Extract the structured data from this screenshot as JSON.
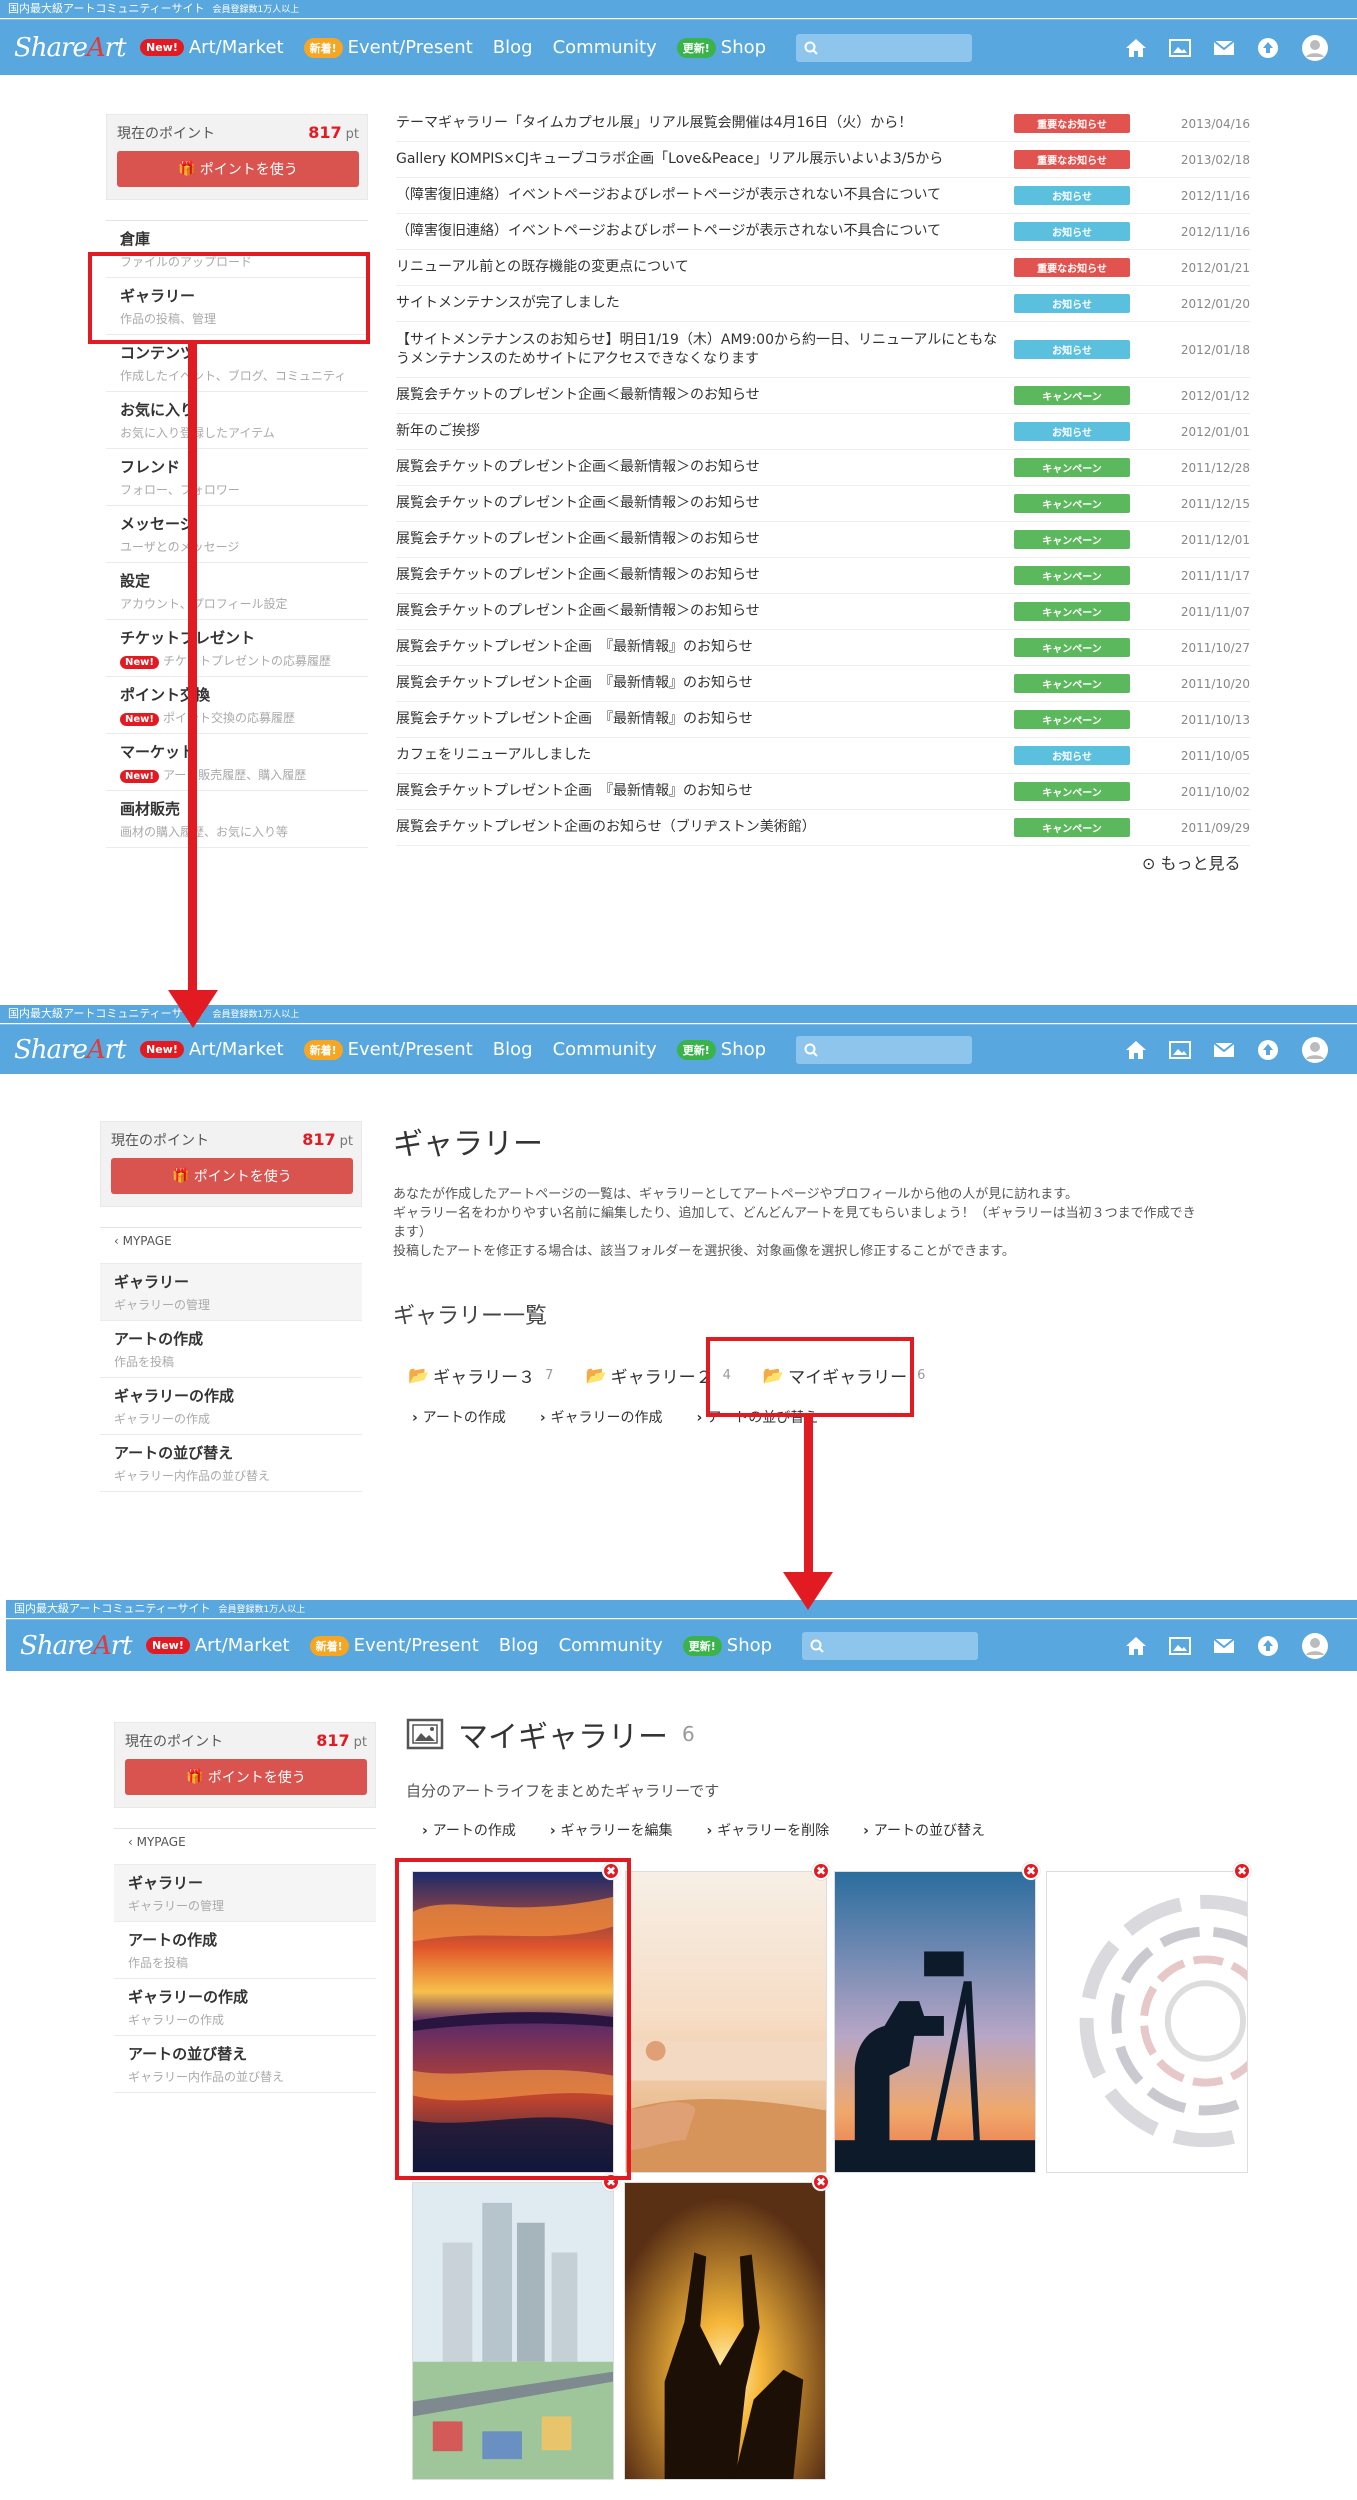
{
  "site": {
    "strip_main": "国内最大級アートコミュニティーサイト",
    "strip_sub": "会員登録数1万人以上",
    "logo": {
      "text_s": "S",
      "text_hare": "hare",
      "text_a": "A",
      "text_rt": "rt"
    },
    "nav": [
      {
        "badge": "New!",
        "badge_color": "#e21b23",
        "label": "Art/Market"
      },
      {
        "badge": "新着!",
        "badge_color": "#f6a623",
        "label": "Event/Present"
      },
      {
        "badge": "",
        "label": "Blog"
      },
      {
        "badge": "",
        "label": "Community"
      },
      {
        "badge": "更新!",
        "badge_color": "#3ab44a",
        "label": "Shop"
      }
    ],
    "icons": [
      "home-icon",
      "gallery-icon",
      "mail-icon",
      "upload-icon",
      "avatar-icon"
    ]
  },
  "points": {
    "label": "現在のポイント",
    "value": "817",
    "unit": "pt",
    "button": "ポイントを使う"
  },
  "screen1": {
    "sidebar": [
      {
        "title": "倉庫",
        "sub": "ファイルのアップロード"
      },
      {
        "title": "ギャラリー",
        "sub": "作品の投稿、管理"
      },
      {
        "title": "コンテンツ",
        "sub": "作成したイベント、ブログ、コミュニティ"
      },
      {
        "title": "お気に入り",
        "sub": "お気に入り登録したアイテム"
      },
      {
        "title": "フレンド",
        "sub": "フォロー、フォロワー"
      },
      {
        "title": "メッセージ",
        "sub": "ユーザとのメッセージ"
      },
      {
        "title": "設定",
        "sub": "アカウント、プロフィール設定"
      },
      {
        "title": "チケットプレゼント",
        "badge": "New!",
        "sub": "チケットプレゼントの応募履歴"
      },
      {
        "title": "ポイント交換",
        "badge": "New!",
        "sub": "ポイント交換の応募履歴"
      },
      {
        "title": "マーケット",
        "badge": "New!",
        "sub": "アート販売履歴、購入履歴"
      },
      {
        "title": "画材販売",
        "sub": "画材の購入履歴、お気に入り等"
      }
    ],
    "news": [
      {
        "title": "テーマギャラリー「タイムカプセル展」リアル展覧会開催は4月16日（火）から！",
        "cat": "重要なお知らせ",
        "color": "#e0534f",
        "date": "2013/04/16"
      },
      {
        "title": "Gallery KOMPIS×CJキューブコラボ企画「Love&Peace」リアル展示いよいよ3/5から",
        "cat": "重要なお知らせ",
        "color": "#e0534f",
        "date": "2013/02/18"
      },
      {
        "title": "（障害復旧連絡）イベントページおよびレポートページが表示されない不具合について",
        "cat": "お知らせ",
        "color": "#5bc0de",
        "date": "2012/11/16"
      },
      {
        "title": "（障害復旧連絡）イベントページおよびレポートページが表示されない不具合について",
        "cat": "お知らせ",
        "color": "#5bc0de",
        "date": "2012/11/16"
      },
      {
        "title": "リニューアル前との既存機能の変更点について",
        "cat": "重要なお知らせ",
        "color": "#e0534f",
        "date": "2012/01/21"
      },
      {
        "title": "サイトメンテナンスが完了しました",
        "cat": "お知らせ",
        "color": "#5bc0de",
        "date": "2012/01/20"
      },
      {
        "title": "【サイトメンテナンスのお知らせ】明日1/19（木）AM9:00から約一日、リニューアルにともなうメンテナンスのためサイトにアクセスできなくなります",
        "cat": "お知らせ",
        "color": "#5bc0de",
        "date": "2012/01/18",
        "tall": true
      },
      {
        "title": "展覧会チケットのプレゼント企画＜最新情報＞のお知らせ",
        "cat": "キャンペーン",
        "color": "#5cb85c",
        "date": "2012/01/12"
      },
      {
        "title": "新年のご挨拶",
        "cat": "お知らせ",
        "color": "#5bc0de",
        "date": "2012/01/01"
      },
      {
        "title": "展覧会チケットのプレゼント企画＜最新情報＞のお知らせ",
        "cat": "キャンペーン",
        "color": "#5cb85c",
        "date": "2011/12/28"
      },
      {
        "title": "展覧会チケットのプレゼント企画＜最新情報＞のお知らせ",
        "cat": "キャンペーン",
        "color": "#5cb85c",
        "date": "2011/12/15"
      },
      {
        "title": "展覧会チケットのプレゼント企画＜最新情報＞のお知らせ",
        "cat": "キャンペーン",
        "color": "#5cb85c",
        "date": "2011/12/01"
      },
      {
        "title": "展覧会チケットのプレゼント企画＜最新情報＞のお知らせ",
        "cat": "キャンペーン",
        "color": "#5cb85c",
        "date": "2011/11/17"
      },
      {
        "title": "展覧会チケットのプレゼント企画＜最新情報＞のお知らせ",
        "cat": "キャンペーン",
        "color": "#5cb85c",
        "date": "2011/11/07"
      },
      {
        "title": "展覧会チケットプレゼント企画　『最新情報』のお知らせ",
        "cat": "キャンペーン",
        "color": "#5cb85c",
        "date": "2011/10/27"
      },
      {
        "title": "展覧会チケットプレゼント企画　『最新情報』のお知らせ",
        "cat": "キャンペーン",
        "color": "#5cb85c",
        "date": "2011/10/20"
      },
      {
        "title": "展覧会チケットプレゼント企画　『最新情報』のお知らせ",
        "cat": "キャンペーン",
        "color": "#5cb85c",
        "date": "2011/10/13"
      },
      {
        "title": "カフェをリニューアルしました",
        "cat": "お知らせ",
        "color": "#5bc0de",
        "date": "2011/10/05"
      },
      {
        "title": "展覧会チケットプレゼント企画　『最新情報』のお知らせ",
        "cat": "キャンペーン",
        "color": "#5cb85c",
        "date": "2011/10/02"
      },
      {
        "title": "展覧会チケットプレゼント企画のお知らせ（ブリヂストン美術館）",
        "cat": "キャンペーン",
        "color": "#5cb85c",
        "date": "2011/09/29"
      }
    ],
    "more": "もっと見る"
  },
  "mypage_sidebar": {
    "back": "MYPAGE",
    "items": [
      {
        "title": "ギャラリー",
        "sub": "ギャラリーの管理"
      },
      {
        "title": "アートの作成",
        "sub": "作品を投稿"
      },
      {
        "title": "ギャラリーの作成",
        "sub": "ギャラリーの作成"
      },
      {
        "title": "アートの並び替え",
        "sub": "ギャラリー内作品の並び替え"
      }
    ]
  },
  "screen2": {
    "heading": "ギャラリー",
    "desc": [
      "あなたが作成したアートページの一覧は、ギャラリーとしてアートページやプロフィールから他の人が見に訪れます。",
      "ギャラリー名をわかりやすい名前に編集したり、追加して、どんどんアートを見てもらいましょう！（ギャラリーは当初３つまで作成でき",
      "ます）",
      "投稿したアートを修正する場合は、該当フォルダーを選択後、対象画像を選択し修正することができます。"
    ],
    "subheading": "ギャラリー一覧",
    "folders": [
      {
        "name": "ギャラリー３",
        "count": "7"
      },
      {
        "name": "ギャラリー２",
        "count": "4"
      },
      {
        "name": "マイギャラリー",
        "count": "6"
      }
    ],
    "actions": [
      "アートの作成",
      "ギャラリーの作成",
      "アートの並び替え"
    ]
  },
  "screen3": {
    "heading": "マイギャラリー",
    "count": "6",
    "desc": "自分のアートライフをまとめたギャラリーです",
    "actions": [
      "アートの作成",
      "ギャラリーを編集",
      "ギャラリーを削除",
      "アートの並び替え"
    ],
    "thumbs": [
      "sunset-sea-painting",
      "meditation-beach-photo",
      "photographer-silhouette-photo",
      "abstract-rings-graphic",
      "city-illustration",
      "sunset-hands-photo"
    ],
    "delete_glyph": "✖"
  }
}
